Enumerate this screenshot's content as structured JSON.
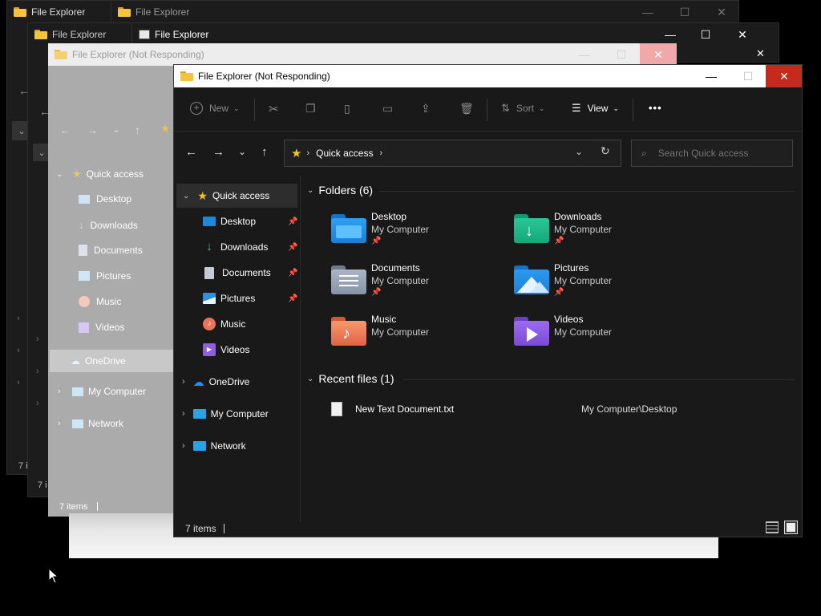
{
  "windows": {
    "back1": {
      "title": "File Explorer",
      "status": "7 i"
    },
    "back2": {
      "title": "File Explorer"
    },
    "back3": {
      "title": "File Explorer",
      "status": "7 i"
    },
    "back4": {
      "title": "File Explorer"
    },
    "ghost": {
      "title": "File Explorer (Not Responding)",
      "status_count": "7 items",
      "nav": [
        "Quick access",
        "Desktop",
        "Downloads",
        "Documents",
        "Pictures",
        "Music",
        "Videos",
        "OneDrive",
        "My Computer",
        "Network"
      ]
    }
  },
  "main": {
    "title": "File Explorer (Not Responding)",
    "toolbar": {
      "new_label": "New",
      "sort_label": "Sort",
      "view_label": "View",
      "more_label": "•••"
    },
    "address": {
      "location": "Quick access",
      "search_placeholder": "Search Quick access"
    },
    "nav": {
      "quick_access": "Quick access",
      "items": [
        "Desktop",
        "Downloads",
        "Documents",
        "Pictures",
        "Music",
        "Videos"
      ],
      "onedrive": "OneDrive",
      "my_computer": "My Computer",
      "network": "Network"
    },
    "folders_header": "Folders (6)",
    "folders": [
      {
        "name": "Desktop",
        "location": "My Computer",
        "pinned": true
      },
      {
        "name": "Downloads",
        "location": "My Computer",
        "pinned": true
      },
      {
        "name": "Documents",
        "location": "My Computer",
        "pinned": true
      },
      {
        "name": "Pictures",
        "location": "My Computer",
        "pinned": true
      },
      {
        "name": "Music",
        "location": "My Computer",
        "pinned": false
      },
      {
        "name": "Videos",
        "location": "My Computer",
        "pinned": false
      }
    ],
    "recent_header": "Recent files (1)",
    "recent": [
      {
        "name": "New Text Document.txt",
        "path": "My Computer\\Desktop"
      }
    ],
    "status_count": "7 items",
    "pin_glyph": "📌"
  },
  "colors": {
    "accent_close": "#c42b1c",
    "bg_dark": "#191919",
    "nav_selected": "#2d2d2d",
    "ghost_bg": "#ababab"
  }
}
